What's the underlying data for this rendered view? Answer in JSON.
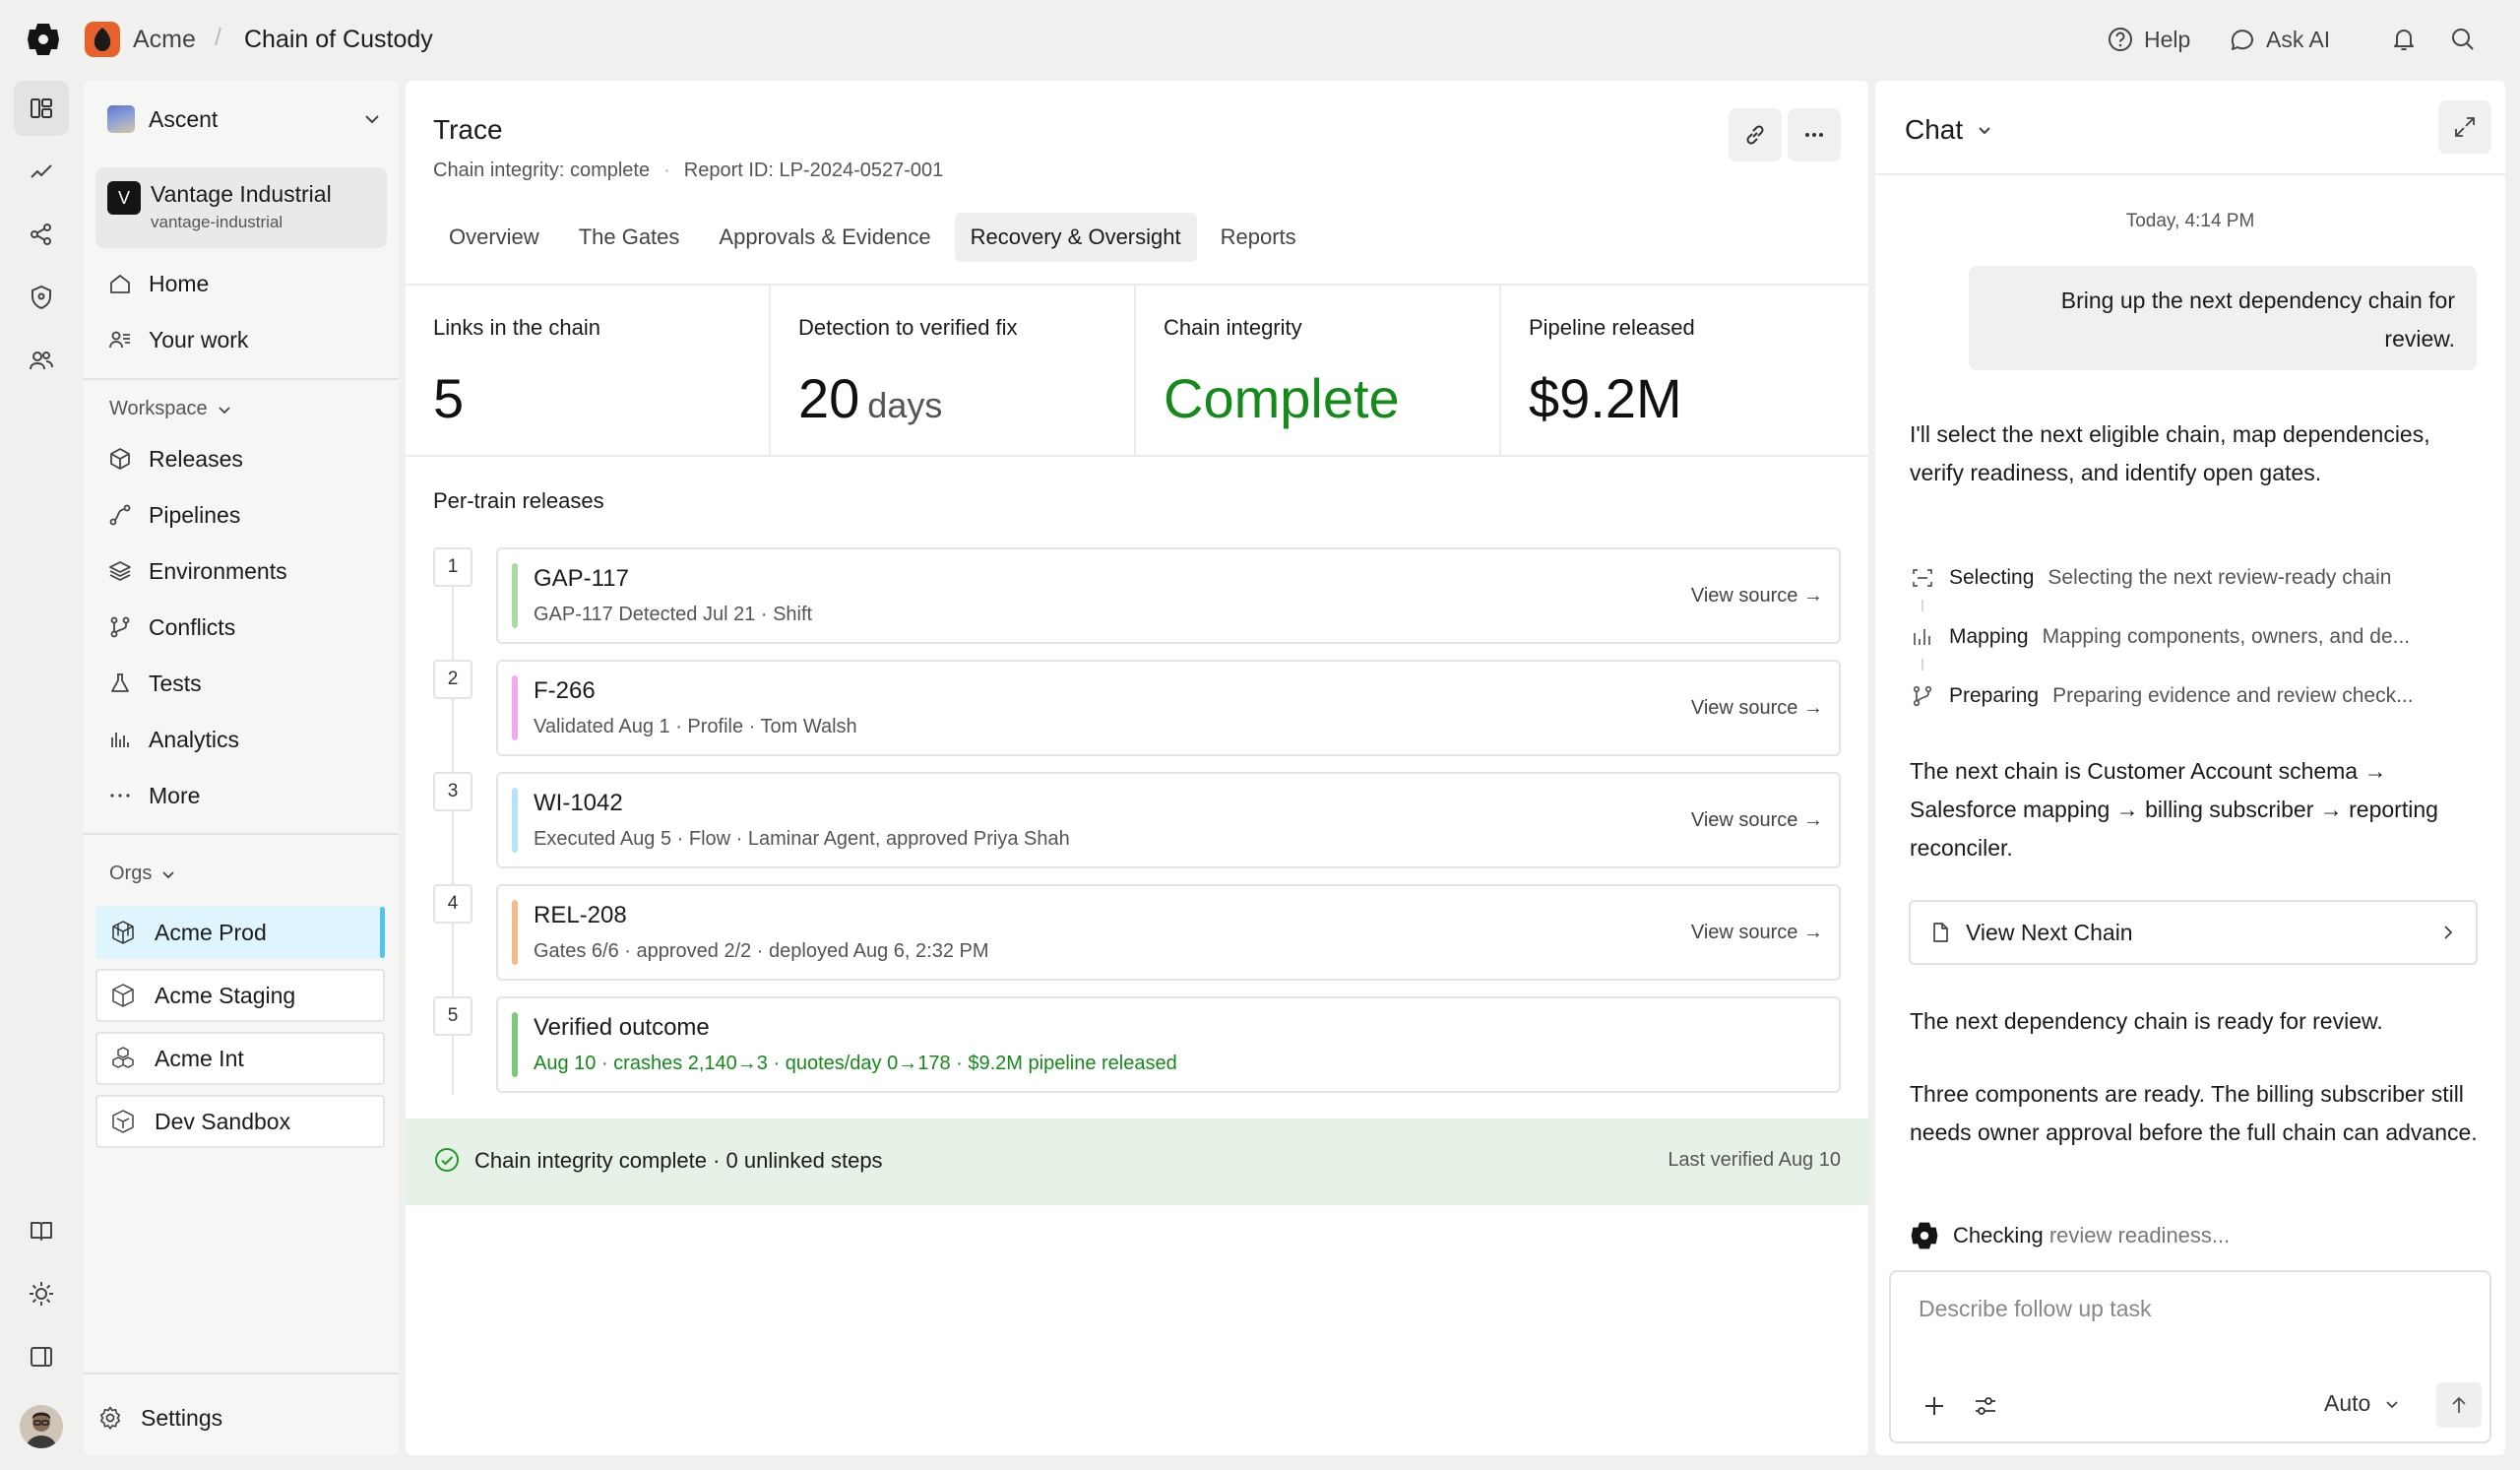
{
  "breadcrumb": {
    "org": "Acme",
    "page": "Chain of Custody"
  },
  "topbar": {
    "help_label": "Help",
    "ask_ai_label": "Ask AI"
  },
  "sidebar": {
    "team": "Ascent",
    "workspace": {
      "badge": "V",
      "name": "Vantage Industrial",
      "slug": "vantage-industrial"
    },
    "primary": [
      {
        "label": "Home",
        "icon": "home-icon"
      },
      {
        "label": "Your work",
        "icon": "user-list-icon"
      }
    ],
    "workspace_header": "Workspace",
    "workspace_items": [
      {
        "label": "Releases",
        "icon": "package-icon"
      },
      {
        "label": "Pipelines",
        "icon": "pipeline-icon"
      },
      {
        "label": "Environments",
        "icon": "layers-icon"
      },
      {
        "label": "Conflicts",
        "icon": "branch-icon"
      },
      {
        "label": "Tests",
        "icon": "flask-icon"
      },
      {
        "label": "Analytics",
        "icon": "bar-chart-icon"
      },
      {
        "label": "More",
        "icon": "ellipsis-icon"
      }
    ],
    "orgs_header": "Orgs",
    "orgs": [
      {
        "label": "Acme Prod",
        "active": true
      },
      {
        "label": "Acme Staging",
        "active": false
      },
      {
        "label": "Acme Int",
        "active": false
      },
      {
        "label": "Dev Sandbox",
        "active": false
      }
    ],
    "settings_label": "Settings"
  },
  "main": {
    "title": "Trace",
    "subtitle_status": "Chain integrity: complete",
    "subtitle_sep": "·",
    "subtitle_report": "Report ID: LP-2024-0527-001",
    "tabs": [
      "Overview",
      "The Gates",
      "Approvals & Evidence",
      "Recovery & Oversight",
      "Reports"
    ],
    "active_tab": "Recovery & Oversight",
    "stats": [
      {
        "label": "Links in the chain",
        "value": "5",
        "unit": ""
      },
      {
        "label": "Detection to verified fix",
        "value": "20",
        "unit": "days"
      },
      {
        "label": "Chain integrity",
        "value": "Complete",
        "unit": ""
      },
      {
        "label": "Pipeline released",
        "value": "$9.2M",
        "unit": ""
      }
    ],
    "section_title": "Per-train releases",
    "releases": [
      {
        "num": "1",
        "title": "GAP-117",
        "sub": "GAP-117 Detected Jul 21 · Shift",
        "link": "View source →",
        "color": "#a9dba3"
      },
      {
        "num": "2",
        "title": "F-266",
        "sub": "Validated Aug 1 · Profile · Tom Walsh",
        "link": "View source →",
        "color": "#f2a9f2"
      },
      {
        "num": "3",
        "title": "WI-1042",
        "sub": "Executed Aug 5 · Flow · Laminar Agent, approved Priya Shah",
        "link": "View source →",
        "color": "#b6e3f7"
      },
      {
        "num": "4",
        "title": "REL-208",
        "sub": "Gates 6/6 · approved 2/2 · deployed Aug 6, 2:32 PM",
        "link": "View source →",
        "color": "#f6b98a"
      },
      {
        "num": "5",
        "title": "Verified outcome",
        "sub": "Aug 10 · crashes 2,140→3 · quotes/day 0→178 · $9.2M pipeline released",
        "link": "",
        "color": "#7cc97c"
      }
    ],
    "integrity_text": "Chain integrity complete · 0 unlinked steps",
    "integrity_right": "Last verified Aug 10"
  },
  "chat": {
    "title": "Chat",
    "timestamp": "Today, 4:14 PM",
    "user_message": "Bring up the next dependency chain for review.",
    "intro": "I'll select the next eligible chain, map dependencies, verify readiness, and identify open gates.",
    "steps": [
      {
        "key": "Selecting",
        "desc": "Selecting the next review-ready chain",
        "icon": "scan-icon"
      },
      {
        "key": "Mapping",
        "desc": "Mapping components, owners, and de...",
        "icon": "bars-icon"
      },
      {
        "key": "Preparing",
        "desc": "Preparing evidence and review check...",
        "icon": "branch-icon"
      }
    ],
    "chain_text": "The next chain is Customer Account schema → Salesforce mapping → billing subscriber → reporting reconciler.",
    "view_next_label": "View Next Chain",
    "ready_text": "The next dependency chain is ready for review.",
    "status_text": "Three components are ready. The billing subscriber still needs owner approval before the full chain can advance.",
    "checking_prefix": "Checking",
    "checking_rest": "review readiness...",
    "composer_placeholder": "Describe follow up task",
    "model_select": "Auto"
  }
}
